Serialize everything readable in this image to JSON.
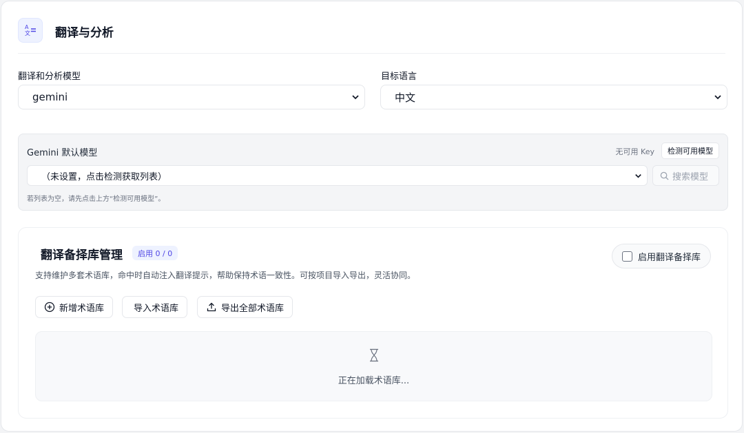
{
  "header": {
    "title": "翻译与分析",
    "icon": "translate-icon"
  },
  "fields": {
    "model_label": "翻译和分析模型",
    "model_value": "gemini",
    "lang_label": "目标语言",
    "lang_value": "中文"
  },
  "gemini": {
    "title": "Gemini 默认模型",
    "key_status": "无可用 Key",
    "detect_label": "检测可用模型",
    "select_value": "（未设置，点击检测获取列表）",
    "search_placeholder": "搜索模型",
    "hint": "若列表为空，请先点击上方“检测可用模型”。"
  },
  "glossary": {
    "title": "翻译备择库管理",
    "badge": "启用 0 / 0",
    "description": "支持维护多套术语库，命中时自动注入翻译提示，帮助保持术语一致性。可按项目导入导出，灵活协同。",
    "enable_label": "启用翻译备择库",
    "enabled": false,
    "buttons": {
      "add": "新增术语库",
      "import": "导入术语库",
      "export": "导出全部术语库"
    },
    "loading_text": "正在加载术语库..."
  },
  "colors": {
    "accent": "#4f46e5",
    "accent_bg": "#eef2ff"
  }
}
